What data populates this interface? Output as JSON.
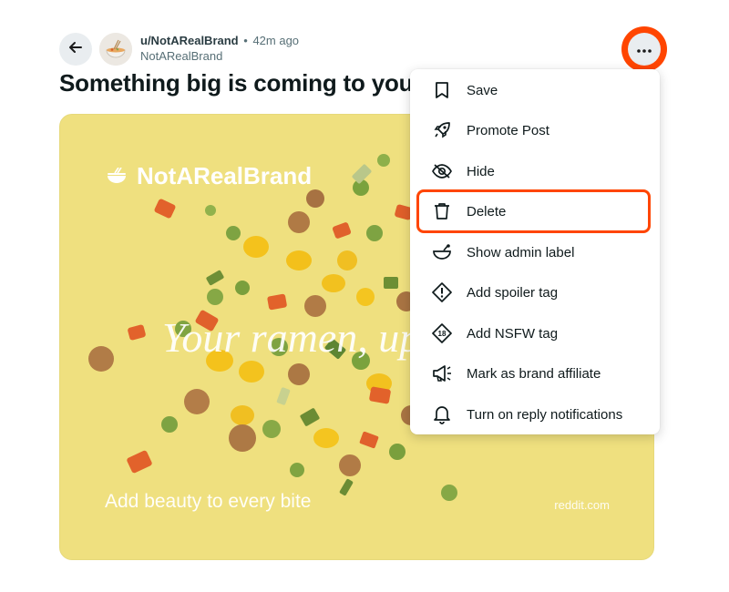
{
  "post": {
    "username": "u/NotARealBrand",
    "separator": "•",
    "time_ago": "42m ago",
    "subreddit": "NotARealBrand",
    "title": "Something big is coming to your",
    "icons": {
      "back": "arrow-left-icon",
      "avatar": "ramen-bowl-avatar",
      "more": "ellipsis-icon"
    }
  },
  "media": {
    "brand_name": "NotARealBrand",
    "hero_text": "Your ramen, up",
    "tagline": "Add beauty to every bite",
    "footer_url": "reddit.com",
    "background_color": "#efe07f"
  },
  "menu": {
    "items": [
      {
        "label": "Save",
        "icon": "bookmark-icon"
      },
      {
        "label": "Promote Post",
        "icon": "rocket-icon"
      },
      {
        "label": "Hide",
        "icon": "eye-slash-icon"
      },
      {
        "label": "Delete",
        "icon": "trash-icon"
      },
      {
        "label": "Show admin label",
        "icon": "mod-shield-icon"
      },
      {
        "label": "Add spoiler tag",
        "icon": "spoiler-icon"
      },
      {
        "label": "Add NSFW tag",
        "icon": "nsfw-18-icon"
      },
      {
        "label": "Mark as brand affiliate",
        "icon": "megaphone-icon"
      },
      {
        "label": "Turn on reply notifications",
        "icon": "bell-icon"
      }
    ]
  },
  "colors": {
    "highlight": "#ff4500",
    "button_bg": "#e9edf0"
  }
}
